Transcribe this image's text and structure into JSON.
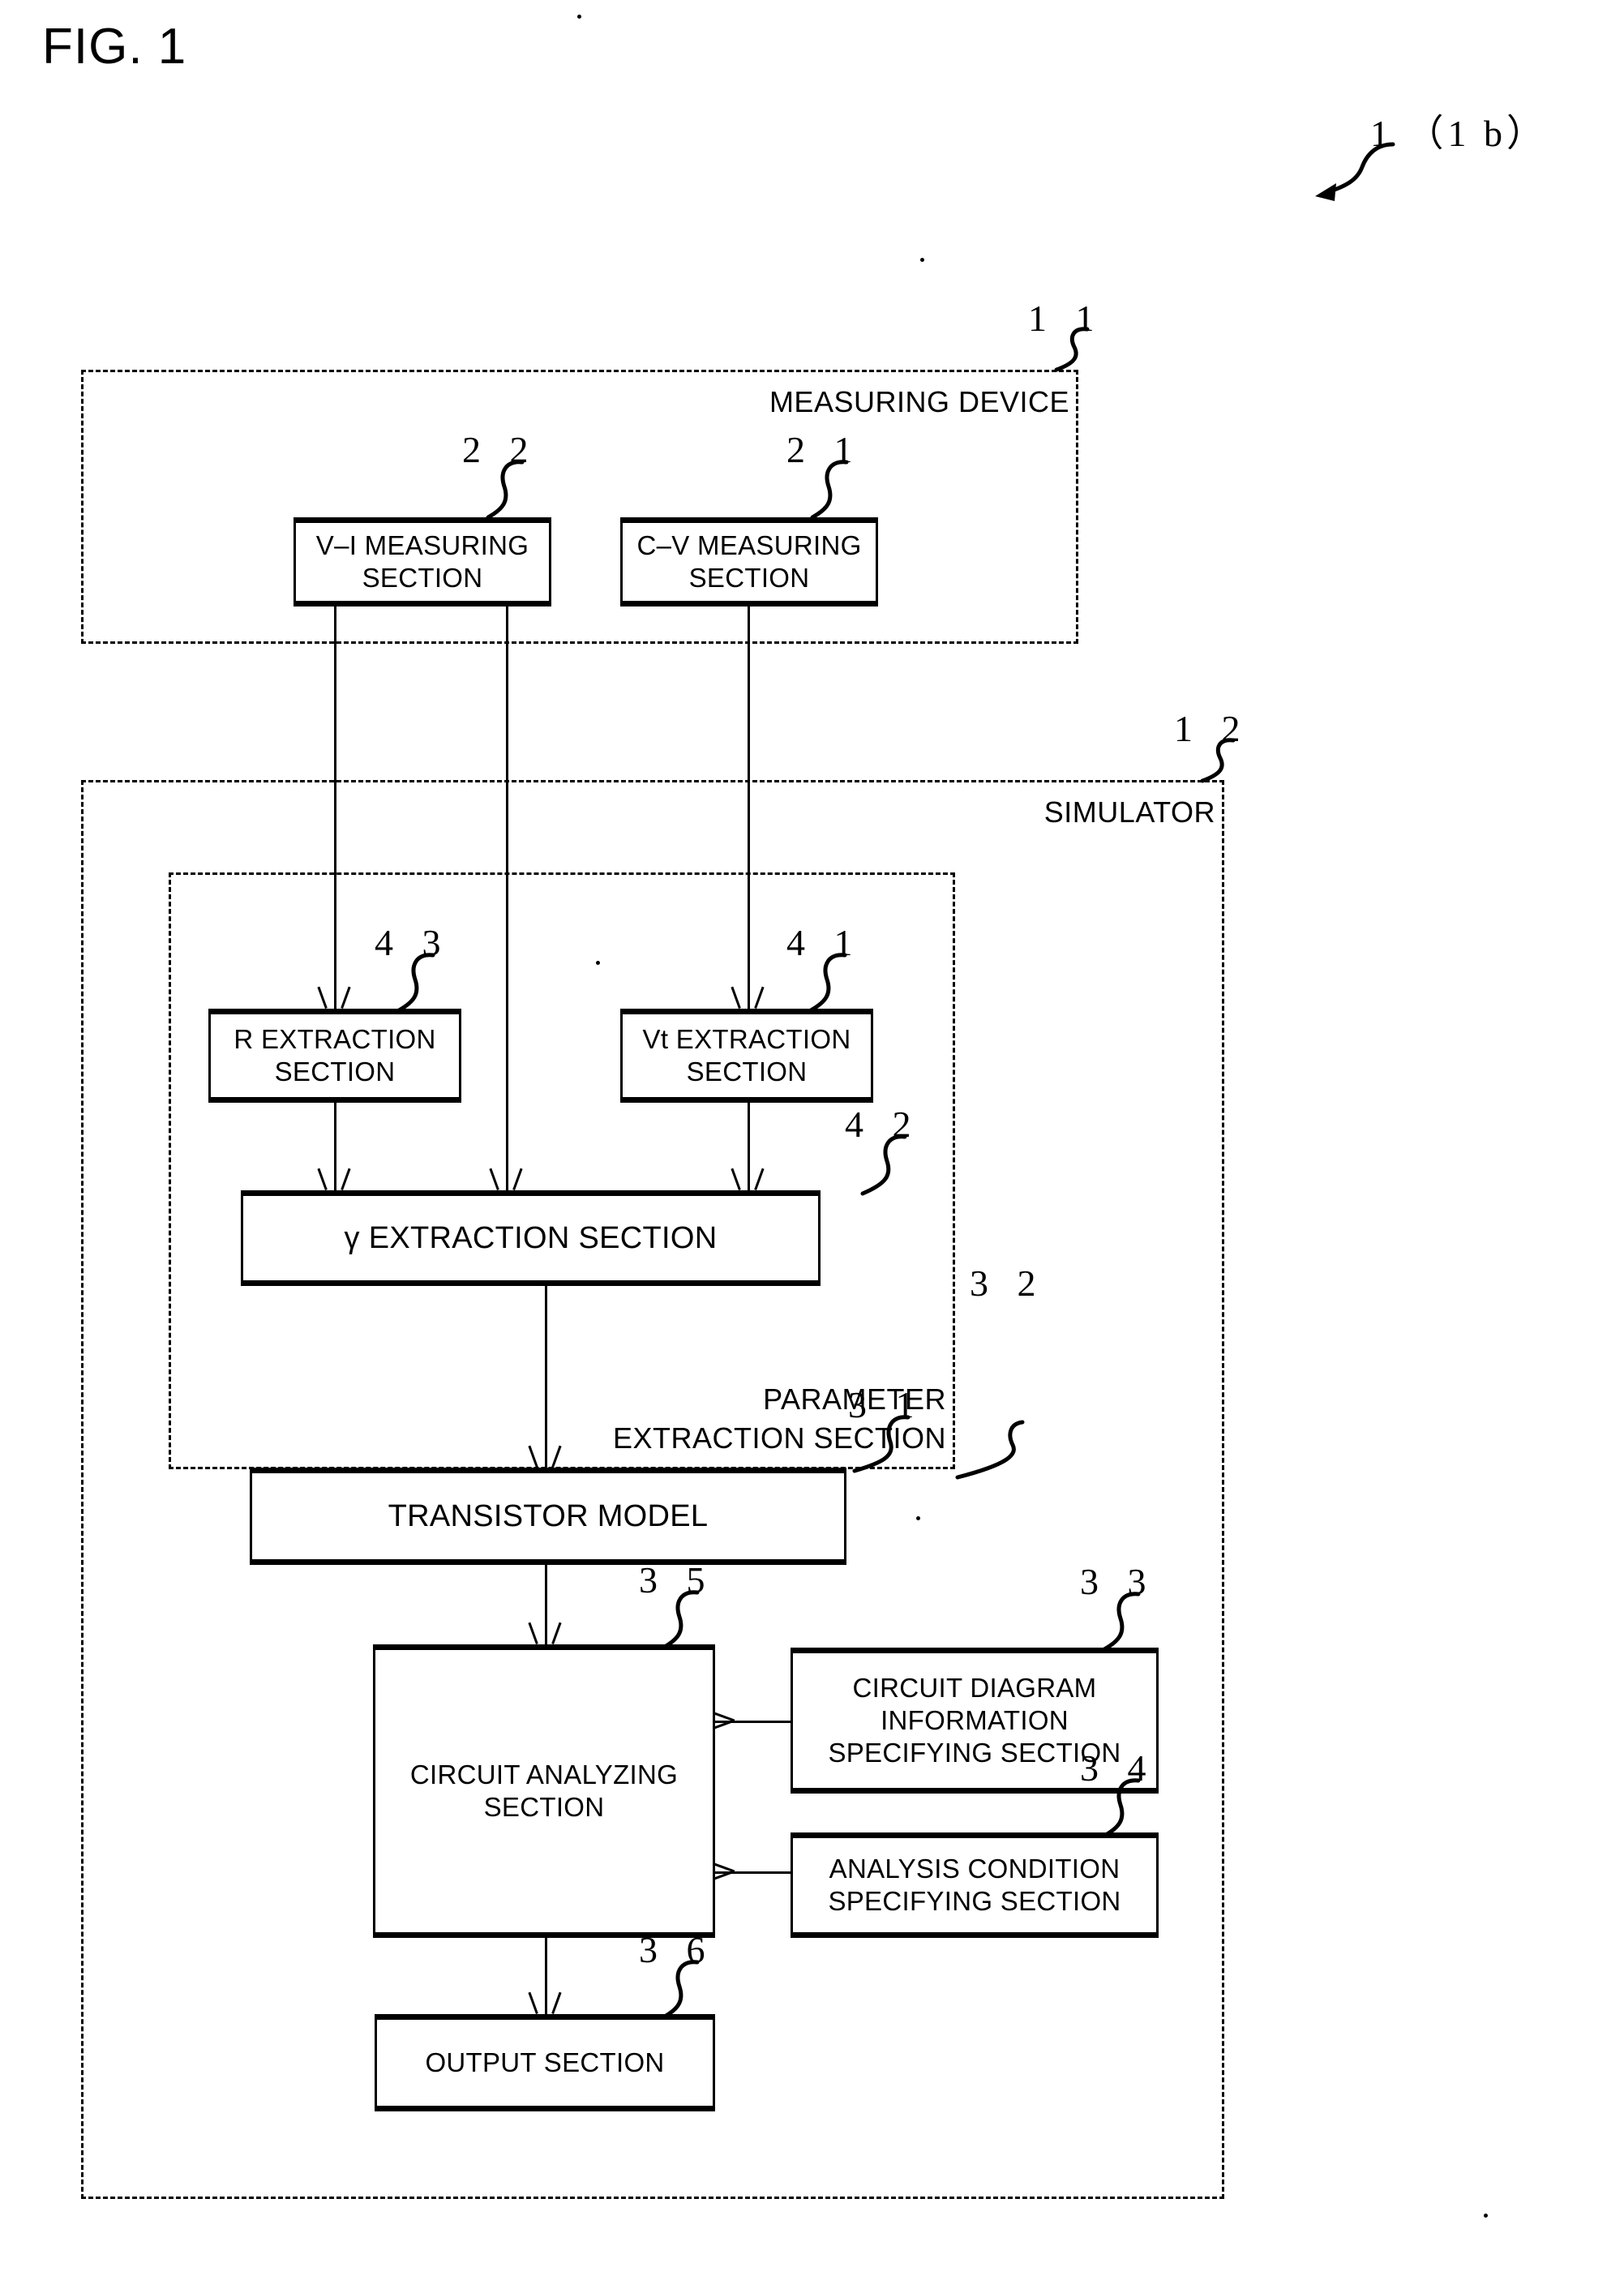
{
  "figure": {
    "title": "FIG. 1",
    "assembly_ref": "1 （1 b）"
  },
  "containers": [
    {
      "id": "measuring-device",
      "label": "MEASURING DEVICE",
      "ref": "1 1"
    },
    {
      "id": "simulator",
      "label": "SIMULATOR",
      "ref": "1 2"
    },
    {
      "id": "parameter-extraction-section",
      "label_line1": "PARAMETER",
      "label_line2": "EXTRACTION SECTION",
      "ref": "3 2"
    }
  ],
  "boxes": [
    {
      "id": "vi-measuring-section",
      "line1": "V–I MEASURING",
      "line2": "SECTION",
      "ref": "2 2"
    },
    {
      "id": "cv-measuring-section",
      "line1": "C–V MEASURING",
      "line2": "SECTION",
      "ref": "2 1"
    },
    {
      "id": "r-extraction-section",
      "line1": "R EXTRACTION",
      "line2": "SECTION",
      "ref": "4 3"
    },
    {
      "id": "vt-extraction-section",
      "line1": "Vt EXTRACTION",
      "line2": "SECTION",
      "ref": "4 1"
    },
    {
      "id": "gamma-extraction-section",
      "line1": "γ EXTRACTION SECTION",
      "line2": "",
      "ref": "4 2"
    },
    {
      "id": "transistor-model",
      "line1": "TRANSISTOR MODEL",
      "line2": "",
      "ref": "3 1"
    },
    {
      "id": "circuit-analyzing-section",
      "line1": "CIRCUIT ANALYZING",
      "line2": "SECTION",
      "ref": "3 5"
    },
    {
      "id": "circuit-diagram-information-specifying-section",
      "line1": "CIRCUIT DIAGRAM",
      "line2": "INFORMATION",
      "line3": "SPECIFYING SECTION",
      "ref": "3 3"
    },
    {
      "id": "analysis-condition-specifying-section",
      "line1": "ANALYSIS CONDITION",
      "line2": "SPECIFYING SECTION",
      "ref": "3 4"
    },
    {
      "id": "output-section",
      "line1": "OUTPUT SECTION",
      "line2": "",
      "ref": "3 6"
    }
  ]
}
